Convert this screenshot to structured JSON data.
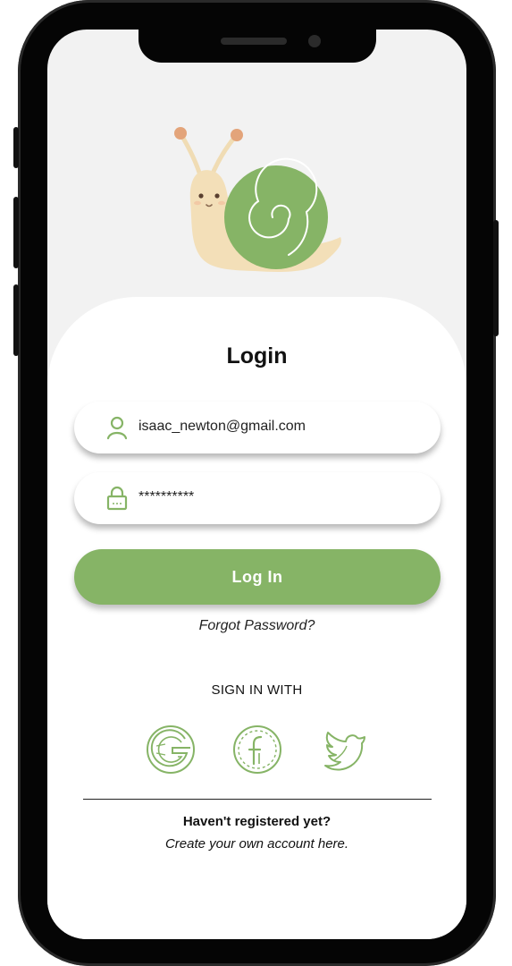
{
  "login": {
    "title": "Login",
    "email_value": "isaac_newton@gmail.com",
    "password_value": "**********",
    "login_button": "Log In",
    "forgot_password": "Forgot Password?"
  },
  "social": {
    "heading": "SIGN IN WITH",
    "providers": [
      "google-icon",
      "facebook-icon",
      "twitter-icon"
    ]
  },
  "register": {
    "title": "Haven't registered yet?",
    "subtitle": "Create your own account here."
  },
  "colors": {
    "accent": "#86b466",
    "background": "#f2f2f2",
    "card": "#ffffff"
  },
  "icons": {
    "email": "user-icon",
    "password": "lock-icon",
    "mascot": "snail-mascot"
  }
}
